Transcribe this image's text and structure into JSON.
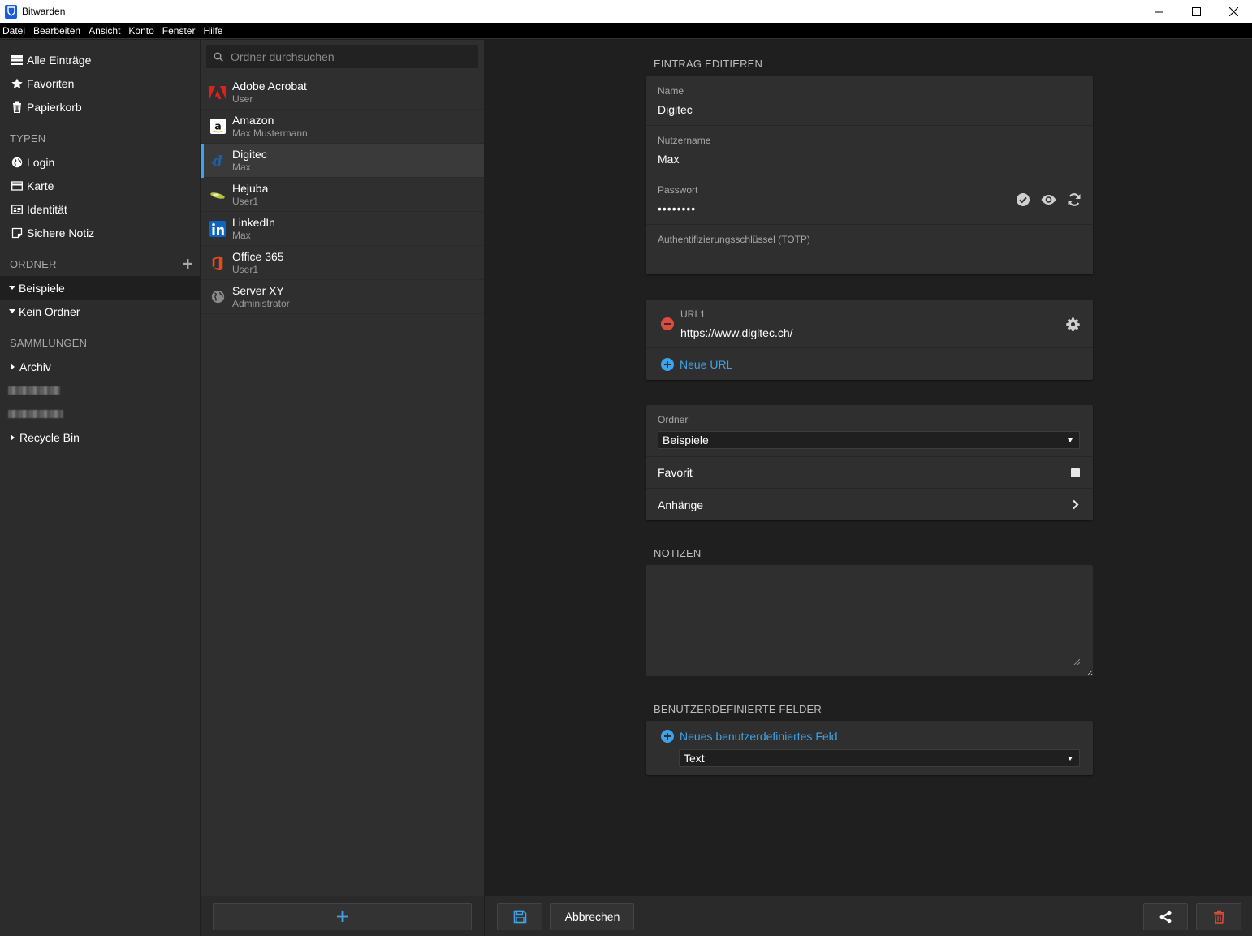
{
  "window": {
    "title": "Bitwarden"
  },
  "menu": [
    "Datei",
    "Bearbeiten",
    "Ansicht",
    "Konto",
    "Fenster",
    "Hilfe"
  ],
  "sidebar": {
    "top_items": [
      {
        "label": "Alle Einträge",
        "icon": "grid-icon"
      },
      {
        "label": "Favoriten",
        "icon": "star-icon"
      },
      {
        "label": "Papierkorb",
        "icon": "trash-icon"
      }
    ],
    "types_heading": "TYPEN",
    "types": [
      {
        "label": "Login",
        "icon": "globe-icon"
      },
      {
        "label": "Karte",
        "icon": "credit-card-icon"
      },
      {
        "label": "Identität",
        "icon": "id-card-icon"
      },
      {
        "label": "Sichere Notiz",
        "icon": "note-icon"
      }
    ],
    "folders_heading": "ORDNER",
    "folders": [
      {
        "label": "Beispiele",
        "active": true
      },
      {
        "label": "Kein Ordner",
        "active": false
      }
    ],
    "collections_heading": "SAMMLUNGEN",
    "collections": [
      {
        "label": "Archiv"
      },
      {
        "label": "Recycle Bin"
      }
    ]
  },
  "search": {
    "placeholder": "Ordner durchsuchen"
  },
  "items": [
    {
      "name": "Adobe Acrobat",
      "sub": "User",
      "logo": "adobe-icon"
    },
    {
      "name": "Amazon",
      "sub": "Max Mustermann",
      "logo": "amazon-icon"
    },
    {
      "name": "Digitec",
      "sub": "Max",
      "logo": "digitec-icon",
      "active": true
    },
    {
      "name": "Hejuba",
      "sub": "User1",
      "logo": "hejuba-icon"
    },
    {
      "name": "LinkedIn",
      "sub": "Max",
      "logo": "linkedin-icon"
    },
    {
      "name": "Office 365",
      "sub": "User1",
      "logo": "office-icon"
    },
    {
      "name": "Server XY",
      "sub": "Administrator",
      "logo": "globe-icon"
    }
  ],
  "edit": {
    "section_title": "EINTRAG EDITIEREN",
    "name_label": "Name",
    "name_value": "Digitec",
    "username_label": "Nutzername",
    "username_value": "Max",
    "password_label": "Passwort",
    "password_value": "••••••••",
    "totp_label": "Authentifizierungsschlüssel (TOTP)",
    "uri_label": "URI 1",
    "uri_value": "https://www.digitec.ch/",
    "new_url": "Neue URL",
    "folder_label": "Ordner",
    "folder_value": "Beispiele",
    "favorite_label": "Favorit",
    "attachments_label": "Anhänge",
    "notes_title": "NOTIZEN",
    "custom_title": "BENUTZERDEFINIERTE FELDER",
    "new_custom_field": "Neues benutzerdefiniertes Feld",
    "custom_type_value": "Text"
  },
  "footer": {
    "cancel": "Abbrechen"
  },
  "colors": {
    "accent": "#3ea3e8",
    "danger": "#e04b3b",
    "brand": "#175ddc"
  }
}
